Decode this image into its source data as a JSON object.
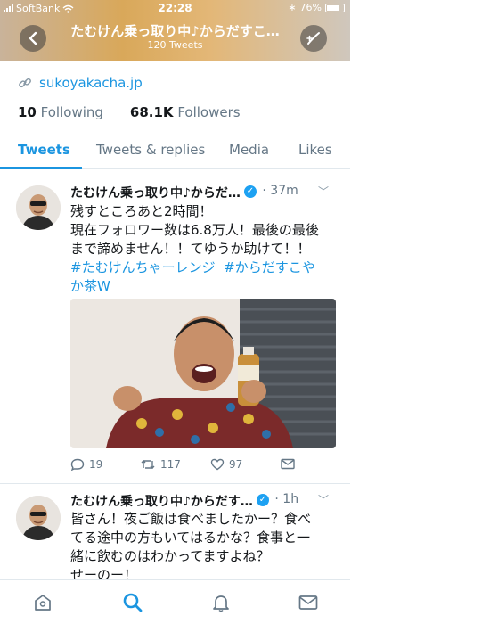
{
  "status": {
    "carrier": "SoftBank",
    "time": "22:28",
    "battery": "76%"
  },
  "header": {
    "title": "たむけん乗っ取り中♪からだすこ…",
    "subtitle": "120 Tweets"
  },
  "profile": {
    "link": "sukoyakacha.jp",
    "following_count": "10",
    "following_label": "Following",
    "followers_count": "68.1K",
    "followers_label": "Followers"
  },
  "tabs": [
    "Tweets",
    "Tweets & replies",
    "Media",
    "Likes"
  ],
  "tweets": [
    {
      "name": "たむけん乗っ取り中♪からだ…",
      "time": "37m",
      "lines": [
        "残すところあと2時間！",
        "現在フォロワー数は6.8万人！最後の最後",
        "まで諦めません！！てゆうか助けて！！"
      ],
      "hashtag1": "#たむけんちゃーレンジ",
      "hashtag2a": "#からだすこや",
      "hashtag2b": "か茶W",
      "replies": "19",
      "retweets": "117",
      "likes": "97",
      "photo_label": "からだすこやか茶W"
    },
    {
      "name": "たむけん乗っ取り中♪からだす…",
      "time": "1h",
      "lines": [
        "皆さん！夜ご飯は食べましたかー？食べ",
        "てる途中の方もいてはるかな？食事と一",
        "緒に飲むのはわかってますよね？",
        "せーのー！"
      ]
    }
  ],
  "colors": {
    "accent": "#1b95e0",
    "muted": "#657786",
    "border": "#e1e8ed"
  }
}
